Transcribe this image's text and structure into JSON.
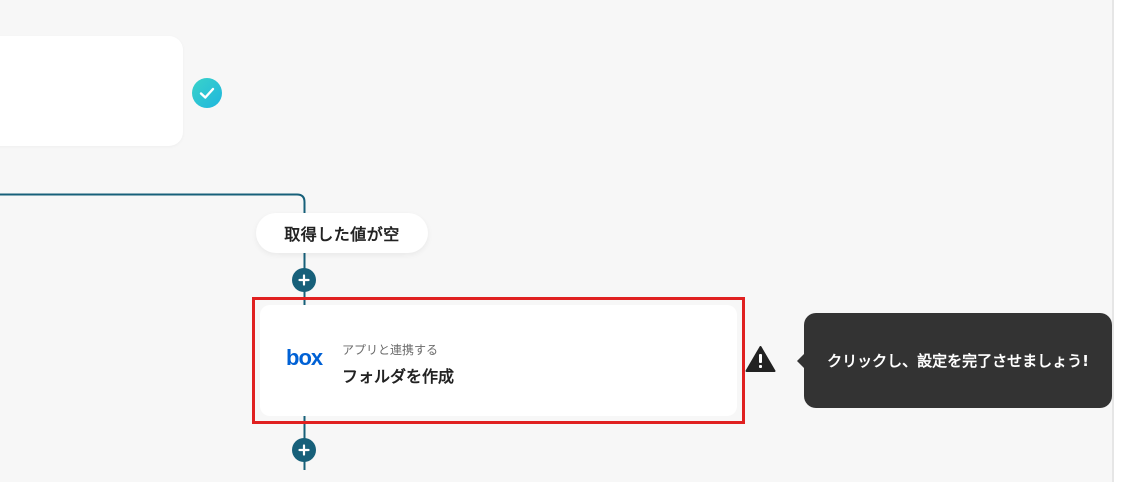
{
  "flow": {
    "condition_label": "取得した値が空",
    "operation": {
      "app_name": "box",
      "subtitle": "アプリと連携する",
      "title": "フォルダを作成"
    },
    "tooltip_text": "クリックし、設定を完了させましょう!"
  },
  "icons": {
    "check": "check-circle-icon",
    "plus": "plus-circle-icon",
    "warning": "warning-icon",
    "app_logo": "box-logo-icon"
  },
  "colors": {
    "highlight_border": "#e02020",
    "plus_button": "#17607a",
    "check_badge": "#22c3d6",
    "tooltip_background": "#333333",
    "box_brand": "#0061d5"
  }
}
